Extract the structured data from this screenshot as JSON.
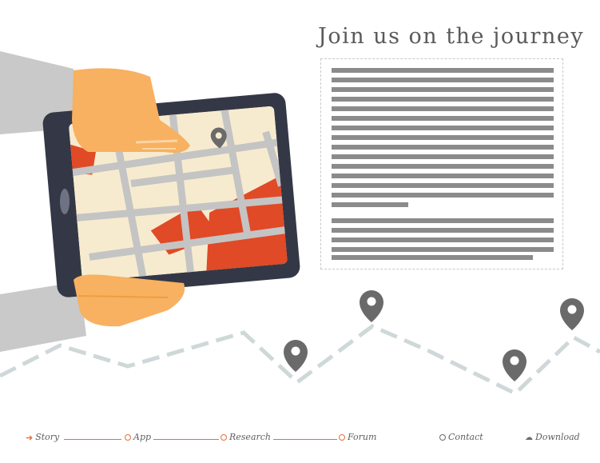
{
  "page": {
    "heading": "Join us on the journey"
  },
  "nav": {
    "items": [
      {
        "label": "Story",
        "marker": "arrow-icon",
        "active": true
      },
      {
        "label": "App",
        "marker": "circle-icon"
      },
      {
        "label": "Research",
        "marker": "circle-icon"
      },
      {
        "label": "Forum",
        "marker": "circle-icon"
      },
      {
        "label": "Contact",
        "marker": "circle-icon"
      },
      {
        "label": "Download",
        "marker": "cloud-download-icon"
      }
    ]
  },
  "colors": {
    "accent": "#e07040",
    "text": "#5f5f5f",
    "map_red": "#e04a26",
    "map_bg": "#f7ebcf",
    "tablet": "#343846",
    "hand": "#f7b161",
    "pin": "#6a6a6a",
    "path": "#cfd8d8"
  }
}
